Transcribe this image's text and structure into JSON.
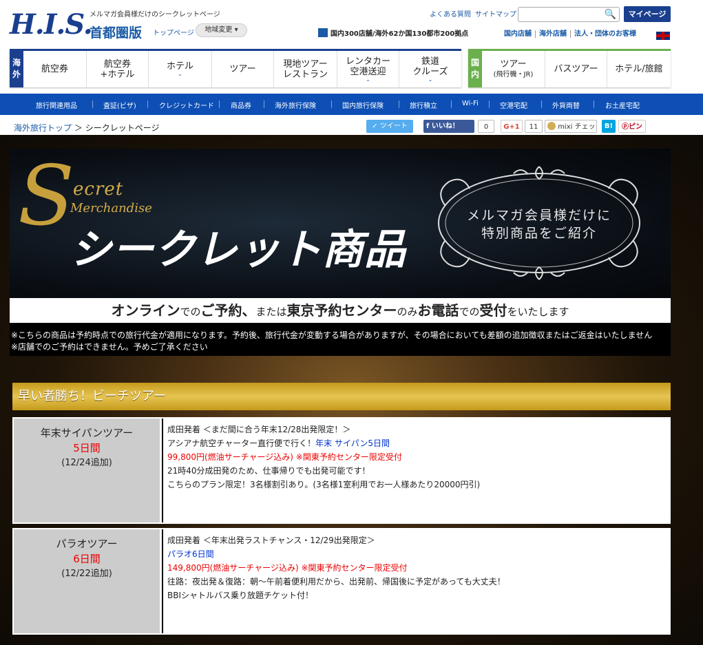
{
  "header": {
    "logo": "H.I.S.",
    "tagline": "メルマガ会員様だけのシークレットページ",
    "region": "首都圏版",
    "top_link": "トップページ",
    "region_change": "地域変更 ▾",
    "faq": "よくある質問",
    "sitemap": "サイトマップ",
    "search_placeholder": "",
    "mypage": "マイページ",
    "stores": "国内300店舗/海外62か国130都市200拠点",
    "links": [
      "国内店舗",
      "海外店舗",
      "法人・団体のお客様"
    ]
  },
  "nav": {
    "overseas_tag": "海外",
    "overseas": [
      {
        "label": "航空券",
        "sub": "",
        "chev": ""
      },
      {
        "label": "航空券\n+ホテル",
        "sub": "",
        "chev": ""
      },
      {
        "label": "ホテル",
        "sub": "",
        "chev": "⌄"
      },
      {
        "label": "ツアー",
        "sub": "",
        "chev": ""
      },
      {
        "label": "現地ツアー\nレストラン",
        "sub": "",
        "chev": ""
      },
      {
        "label": "レンタカー\n空港送迎",
        "sub": "",
        "chev": "⌄"
      },
      {
        "label": "鉄道\nクルーズ",
        "sub": "",
        "chev": "⌄"
      }
    ],
    "domestic_tag": "国内",
    "domestic": [
      {
        "label": "ツアー",
        "sub": "(飛行機・JR)"
      },
      {
        "label": "バスツアー",
        "sub": ""
      },
      {
        "label": "ホテル/旅館",
        "sub": ""
      }
    ]
  },
  "subnav": [
    "旅行関連用品",
    "査証(ビザ)",
    "クレジットカード",
    "商品券",
    "海外旅行保険",
    "国内旅行保険",
    "旅行積立",
    "Wi-Fi",
    "空港宅配",
    "外貨両替",
    "お土産宅配"
  ],
  "breadcrumb": {
    "home": "海外旅行トップ",
    "sep": "＞",
    "current": "シークレットページ"
  },
  "social": {
    "tweet": "ツイート",
    "like": "いいね！",
    "like_count": "0",
    "gplus": "G+1",
    "gplus_count": "11",
    "mixi": "mixi チェック",
    "hatena": "B!",
    "pin": "ピン"
  },
  "banner": {
    "s_letter": "S",
    "secret": "ecret",
    "merchandise": "Merchandise",
    "title": "シークレット商品",
    "frame_line1": "メルマガ会員様だけに",
    "frame_line2": "特別商品をご紹介",
    "booking": {
      "a": "オンライン",
      "b": "での",
      "c": "ご予約、",
      "d": "または",
      "e": "東京予約センター",
      "f": "のみ",
      "g": "お電話",
      "h": "での",
      "i": "受付",
      "j": "をいたします"
    },
    "note1": "※こちらの商品は予約時点での旅行代金が適用になります。予約後、旅行代金が変動する場合がありますが、その場合においても差額の追加徴収またはご返金はいたしません",
    "note2": "※店舗でのご予約はできません。予めご了承ください"
  },
  "section_title": "早い者勝ち！ビーチツアー",
  "tours": [
    {
      "name": "年末サイパンツアー",
      "days": "5日間",
      "added": "(12/24追加)",
      "line1": "成田発着 ＜まだ間に合う年末12/28出発限定！＞",
      "line2_pre": "アシアナ航空チャーター直行便で行く！",
      "line2_link": "年末 サイパン5日間",
      "price": "99,800円(燃油サーチャージ込み) ※関東予約センター限定受付",
      "line4": "21時40分成田発のため、仕事帰りでも出発可能です！",
      "line5": "こちらのプラン限定！3名様割引あり。(3名様1室利用でお一人様あたり20000円引)"
    },
    {
      "name": "パラオツアー",
      "days": "6日間",
      "added": "(12/22追加)",
      "line1": "成田発着 ＜年末出発ラストチャンス・12/29出発限定＞",
      "line2_pre": "",
      "line2_link": "パラオ6日間",
      "price": "149,800円(燃油サーチャージ込み) ※関東予約センター限定受付",
      "line4": "往路：夜出発＆復路：朝〜午前着便利用だから、出発前、帰国後に予定があっても大丈夫！",
      "line5": "BBIシャトルバス乗り放題チケット付！"
    }
  ],
  "colors": {
    "brand": "#1a3f8e",
    "domestic": "#6ab04c",
    "subnav": "#0d4fb5",
    "gold": "#c59a1b",
    "price": "#e00000"
  }
}
